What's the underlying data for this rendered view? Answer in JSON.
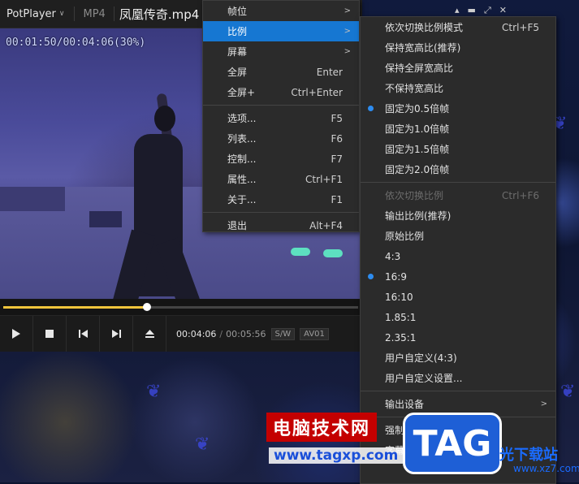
{
  "player": {
    "app_name": "PotPlayer",
    "format": "MP4",
    "file_name": "凤凰传奇.mp4",
    "osd": "00:01:50/00:04:06(30%)",
    "progress_fraction": 0.406,
    "time_current": "00:04:06",
    "time_separator": "/",
    "time_total": "00:05:56",
    "tags": [
      "S/W",
      "AV01"
    ],
    "controls": [
      "play-icon",
      "stop-icon",
      "previous-icon",
      "next-icon",
      "eject-icon"
    ]
  },
  "main_menu": {
    "items": [
      {
        "label": "帧位",
        "shortcut": "",
        "submenu": true
      },
      {
        "label": "比例",
        "shortcut": "",
        "submenu": true,
        "active": true
      },
      {
        "label": "屏幕",
        "shortcut": "",
        "submenu": true
      },
      {
        "label": "全屏",
        "shortcut": "Enter"
      },
      {
        "label": "全屏+",
        "shortcut": "Ctrl+Enter"
      },
      {
        "label": "选项...",
        "shortcut": "F5"
      },
      {
        "label": "列表...",
        "shortcut": "F6"
      },
      {
        "label": "控制...",
        "shortcut": "F7"
      },
      {
        "label": "属性...",
        "shortcut": "Ctrl+F1"
      },
      {
        "label": "关于...",
        "shortcut": "F1"
      },
      {
        "label": "退出",
        "shortcut": "Alt+F4"
      }
    ]
  },
  "ratio_menu": {
    "items": [
      {
        "label": "依次切换比例模式",
        "shortcut": "Ctrl+F5"
      },
      {
        "label": "保持宽高比(推荐)",
        "shortcut": ""
      },
      {
        "label": "保持全屏宽高比",
        "shortcut": ""
      },
      {
        "label": "不保持宽高比",
        "shortcut": ""
      },
      {
        "label": "固定为0.5倍帧",
        "shortcut": "",
        "selected": true
      },
      {
        "label": "固定为1.0倍帧",
        "shortcut": ""
      },
      {
        "label": "固定为1.5倍帧",
        "shortcut": ""
      },
      {
        "label": "固定为2.0倍帧",
        "shortcut": ""
      },
      {
        "label": "依次切换比例",
        "shortcut": "Ctrl+F6",
        "disabled": true
      },
      {
        "label": "输出比例(推荐)",
        "shortcut": ""
      },
      {
        "label": "原始比例",
        "shortcut": ""
      },
      {
        "label": "4:3",
        "shortcut": ""
      },
      {
        "label": "16:9",
        "shortcut": "",
        "selected": true
      },
      {
        "label": "16:10",
        "shortcut": ""
      },
      {
        "label": "1.85:1",
        "shortcut": ""
      },
      {
        "label": "2.35:1",
        "shortcut": ""
      },
      {
        "label": "用户自定义(4:3)",
        "shortcut": ""
      },
      {
        "label": "用户自定义设置...",
        "shortcut": ""
      },
      {
        "label": "输出设备",
        "shortcut": "",
        "submenu": true
      },
      {
        "label": "强制转换为8:5",
        "shortcut": "",
        "checked": true
      },
      {
        "label": "字幕边距",
        "shortcut": ""
      }
    ]
  },
  "watermark": {
    "site_name": "电脑技术网",
    "url": "www.tagxp.com",
    "logo": "TAG",
    "right_text": "光下载站",
    "right_url": "www.xz7.com"
  }
}
